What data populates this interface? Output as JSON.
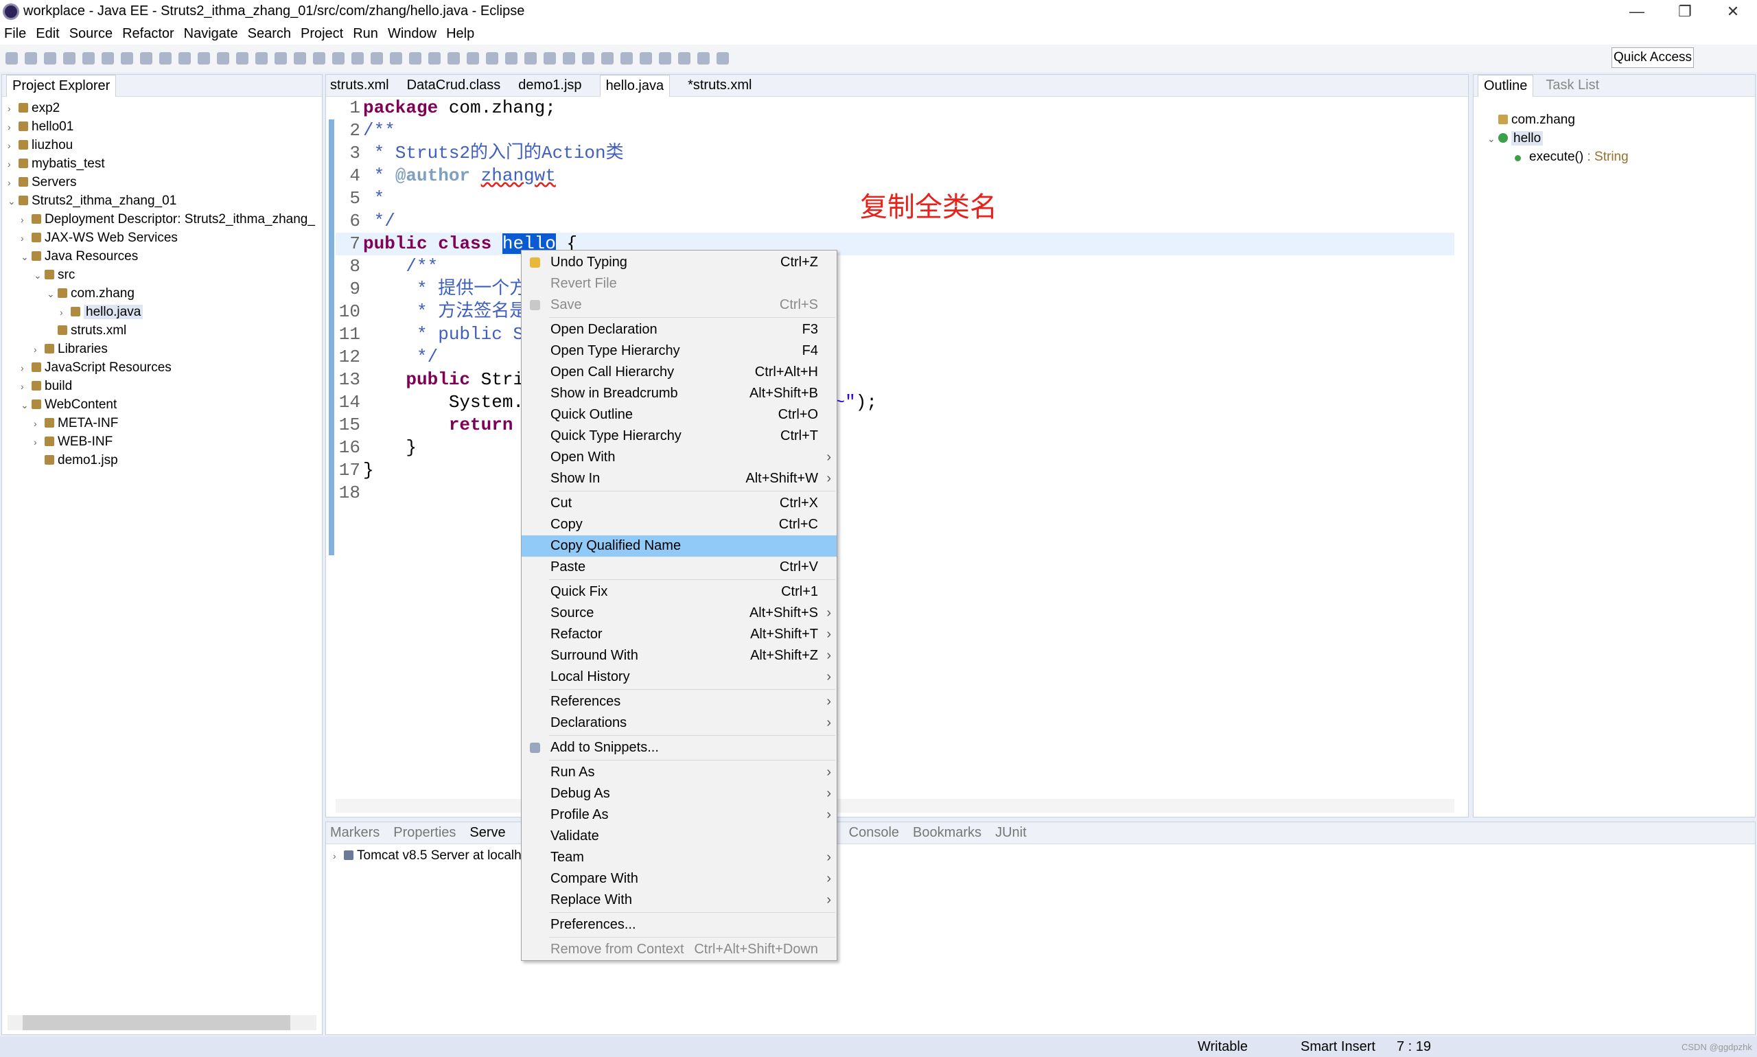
{
  "window": {
    "title": "workplace - Java EE - Struts2_ithma_zhang_01/src/com/zhang/hello.java - Eclipse",
    "controls": [
      "—",
      "❐",
      "✕"
    ]
  },
  "menubar": [
    "File",
    "Edit",
    "Source",
    "Refactor",
    "Navigate",
    "Search",
    "Project",
    "Run",
    "Window",
    "Help"
  ],
  "toolbar": {
    "quick_access": "Quick Access"
  },
  "project_explorer": {
    "title": "Project Explorer",
    "items": [
      {
        "label": "exp2",
        "depth": 0,
        "tw": "›"
      },
      {
        "label": "hello01",
        "depth": 0,
        "tw": "›"
      },
      {
        "label": "liuzhou",
        "depth": 0,
        "tw": "›"
      },
      {
        "label": "mybatis_test",
        "depth": 0,
        "tw": "›"
      },
      {
        "label": "Servers",
        "depth": 0,
        "tw": "›"
      },
      {
        "label": "Struts2_ithma_zhang_01",
        "depth": 0,
        "tw": "⌄"
      },
      {
        "label": "Deployment Descriptor: Struts2_ithma_zhang_",
        "depth": 1,
        "tw": "›"
      },
      {
        "label": "JAX-WS Web Services",
        "depth": 1,
        "tw": "›"
      },
      {
        "label": "Java Resources",
        "depth": 1,
        "tw": "⌄"
      },
      {
        "label": "src",
        "depth": 2,
        "tw": "⌄"
      },
      {
        "label": "com.zhang",
        "depth": 3,
        "tw": "⌄"
      },
      {
        "label": "hello.java",
        "depth": 4,
        "tw": "›",
        "selected": true
      },
      {
        "label": "struts.xml",
        "depth": 3,
        "tw": ""
      },
      {
        "label": "Libraries",
        "depth": 2,
        "tw": "›"
      },
      {
        "label": "JavaScript Resources",
        "depth": 1,
        "tw": "›"
      },
      {
        "label": "build",
        "depth": 1,
        "tw": "›"
      },
      {
        "label": "WebContent",
        "depth": 1,
        "tw": "⌄"
      },
      {
        "label": "META-INF",
        "depth": 2,
        "tw": "›"
      },
      {
        "label": "WEB-INF",
        "depth": 2,
        "tw": "›"
      },
      {
        "label": "demo1.jsp",
        "depth": 2,
        "tw": ""
      }
    ]
  },
  "editor": {
    "tabs": [
      "struts.xml",
      "DataCrud.class",
      "demo1.jsp",
      "hello.java",
      "*struts.xml"
    ],
    "active_tab": 3,
    "annotation": "复制全类名",
    "annotation_color": "#e8211a",
    "lines": [
      {
        "n": "1",
        "html": "<span class='kw'>package</span> com.zhang;"
      },
      {
        "n": "2",
        "html": "<span class='cm'>/**</span>"
      },
      {
        "n": "3",
        "html": "<span class='cm'> * Struts2的入门的Action类</span>"
      },
      {
        "n": "4",
        "html": "<span class='cm'> * <span style='color:#7f9fbf;font-weight:bold'>@author</span> <u style='text-decoration-color:#e8211a;text-decoration-style:wavy'>zhangwt</u></span>"
      },
      {
        "n": "5",
        "html": "<span class='cm'> *</span>"
      },
      {
        "n": "6",
        "html": "<span class='cm'> */</span>"
      },
      {
        "n": "7",
        "html": "<span class='kw'>public</span> <span class='kw'>class</span> <span class='sel'>hello</span> {"
      },
      {
        "n": "8",
        "html": "    <span class='cm'>/**</span>"
      },
      {
        "n": "9",
        "html": "<span class='cm'>     * 提供一个方</span>"
      },
      {
        "n": "10",
        "html": "<span class='cm'>     * 方法签名是</span>"
      },
      {
        "n": "11",
        "html": "<span class='cm'>     * public St</span>"
      },
      {
        "n": "12",
        "html": "<span class='cm'>     */</span>"
      },
      {
        "n": "13",
        "html": "    <span class='kw'>public</span> Strin"
      },
      {
        "n": "14",
        "html": "        System.<i style='color:#0000c0;font-weight:bold'>o</i>                         <span style='color:#2a00ff'>~~~~\"</span>);"
      },
      {
        "n": "15",
        "html": "        <span class='kw'>return</span> <span class='kw'>n</span>"
      },
      {
        "n": "16",
        "html": "    }"
      },
      {
        "n": "17",
        "html": "}"
      },
      {
        "n": "18",
        "html": ""
      }
    ]
  },
  "outline": {
    "tabs": [
      "Outline",
      "Task List"
    ],
    "items": [
      {
        "label": "com.zhang"
      },
      {
        "label": "hello"
      },
      {
        "label": "execute()",
        "type": " : String"
      }
    ]
  },
  "bottom": {
    "tabs": [
      "Markers",
      "Properties",
      "Serve",
      "Console",
      "Bookmarks",
      "JUnit"
    ],
    "server": "Tomcat v8.5 Server at localh"
  },
  "context_menu": [
    {
      "label": "Undo Typing",
      "sc": "Ctrl+Z",
      "icon": "undo"
    },
    {
      "label": "Revert File",
      "sc": "",
      "dis": true
    },
    {
      "label": "Save",
      "sc": "Ctrl+S",
      "dis": true,
      "icon": "save"
    },
    {
      "sep": true
    },
    {
      "label": "Open Declaration",
      "sc": "F3"
    },
    {
      "label": "Open Type Hierarchy",
      "sc": "F4"
    },
    {
      "label": "Open Call Hierarchy",
      "sc": "Ctrl+Alt+H"
    },
    {
      "label": "Show in Breadcrumb",
      "sc": "Alt+Shift+B"
    },
    {
      "label": "Quick Outline",
      "sc": "Ctrl+O"
    },
    {
      "label": "Quick Type Hierarchy",
      "sc": "Ctrl+T"
    },
    {
      "label": "Open With",
      "sc": "",
      "sub": true
    },
    {
      "label": "Show In",
      "sc": "Alt+Shift+W",
      "sub": true
    },
    {
      "sep": true
    },
    {
      "label": "Cut",
      "sc": "Ctrl+X"
    },
    {
      "label": "Copy",
      "sc": "Ctrl+C"
    },
    {
      "label": "Copy Qualified Name",
      "sc": "",
      "hl": true
    },
    {
      "label": "Paste",
      "sc": "Ctrl+V"
    },
    {
      "sep": true
    },
    {
      "label": "Quick Fix",
      "sc": "Ctrl+1"
    },
    {
      "label": "Source",
      "sc": "Alt+Shift+S",
      "sub": true
    },
    {
      "label": "Refactor",
      "sc": "Alt+Shift+T",
      "sub": true
    },
    {
      "label": "Surround With",
      "sc": "Alt+Shift+Z",
      "sub": true
    },
    {
      "label": "Local History",
      "sc": "",
      "sub": true
    },
    {
      "sep": true
    },
    {
      "label": "References",
      "sc": "",
      "sub": true
    },
    {
      "label": "Declarations",
      "sc": "",
      "sub": true
    },
    {
      "sep": true
    },
    {
      "label": "Add to Snippets...",
      "sc": "",
      "icon": "snippet"
    },
    {
      "sep": true
    },
    {
      "label": "Run As",
      "sc": "",
      "sub": true
    },
    {
      "label": "Debug As",
      "sc": "",
      "sub": true
    },
    {
      "label": "Profile As",
      "sc": "",
      "sub": true
    },
    {
      "label": "Validate",
      "sc": ""
    },
    {
      "label": "Team",
      "sc": "",
      "sub": true
    },
    {
      "label": "Compare With",
      "sc": "",
      "sub": true
    },
    {
      "label": "Replace With",
      "sc": "",
      "sub": true
    },
    {
      "sep": true
    },
    {
      "label": "Preferences...",
      "sc": ""
    },
    {
      "sep": true
    },
    {
      "label": "Remove from Context",
      "sc": "Ctrl+Alt+Shift+Down",
      "dis": true
    }
  ],
  "status": {
    "writable": "Writable",
    "insert": "Smart Insert",
    "position": "7 : 19",
    "watermark": "CSDN @ggdpzhk"
  }
}
